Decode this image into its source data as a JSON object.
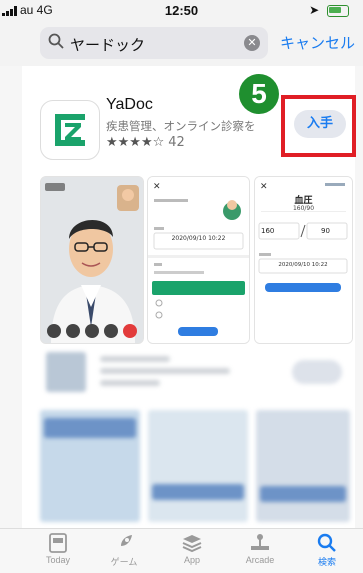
{
  "status_bar": {
    "carrier": "au 4G",
    "time": "12:50"
  },
  "search": {
    "query": "ヤードック",
    "cancel_label": "キャンセル"
  },
  "app": {
    "name": "YaDoc",
    "subtitle": "疾患管理、オンライン診察を",
    "stars": "★★★★☆",
    "rating_count": "42",
    "get_label": "入手"
  },
  "annotation": {
    "step_number": "5"
  },
  "screenshots": {
    "shot2": {
      "date": "2020/09/10 10:22"
    },
    "shot3": {
      "title": "血圧",
      "range_label": "160/90",
      "upper": "160",
      "lower": "90",
      "date": "2020/09/10 10:22"
    }
  },
  "tabs": [
    {
      "label": "Today"
    },
    {
      "label": "ゲーム"
    },
    {
      "label": "App"
    },
    {
      "label": "Arcade"
    },
    {
      "label": "検索"
    }
  ],
  "colors": {
    "accent": "#1a7cf0",
    "annotation_red": "#e01e25",
    "annotation_green": "#1f8f2f",
    "brand_green": "#1aa36b"
  }
}
